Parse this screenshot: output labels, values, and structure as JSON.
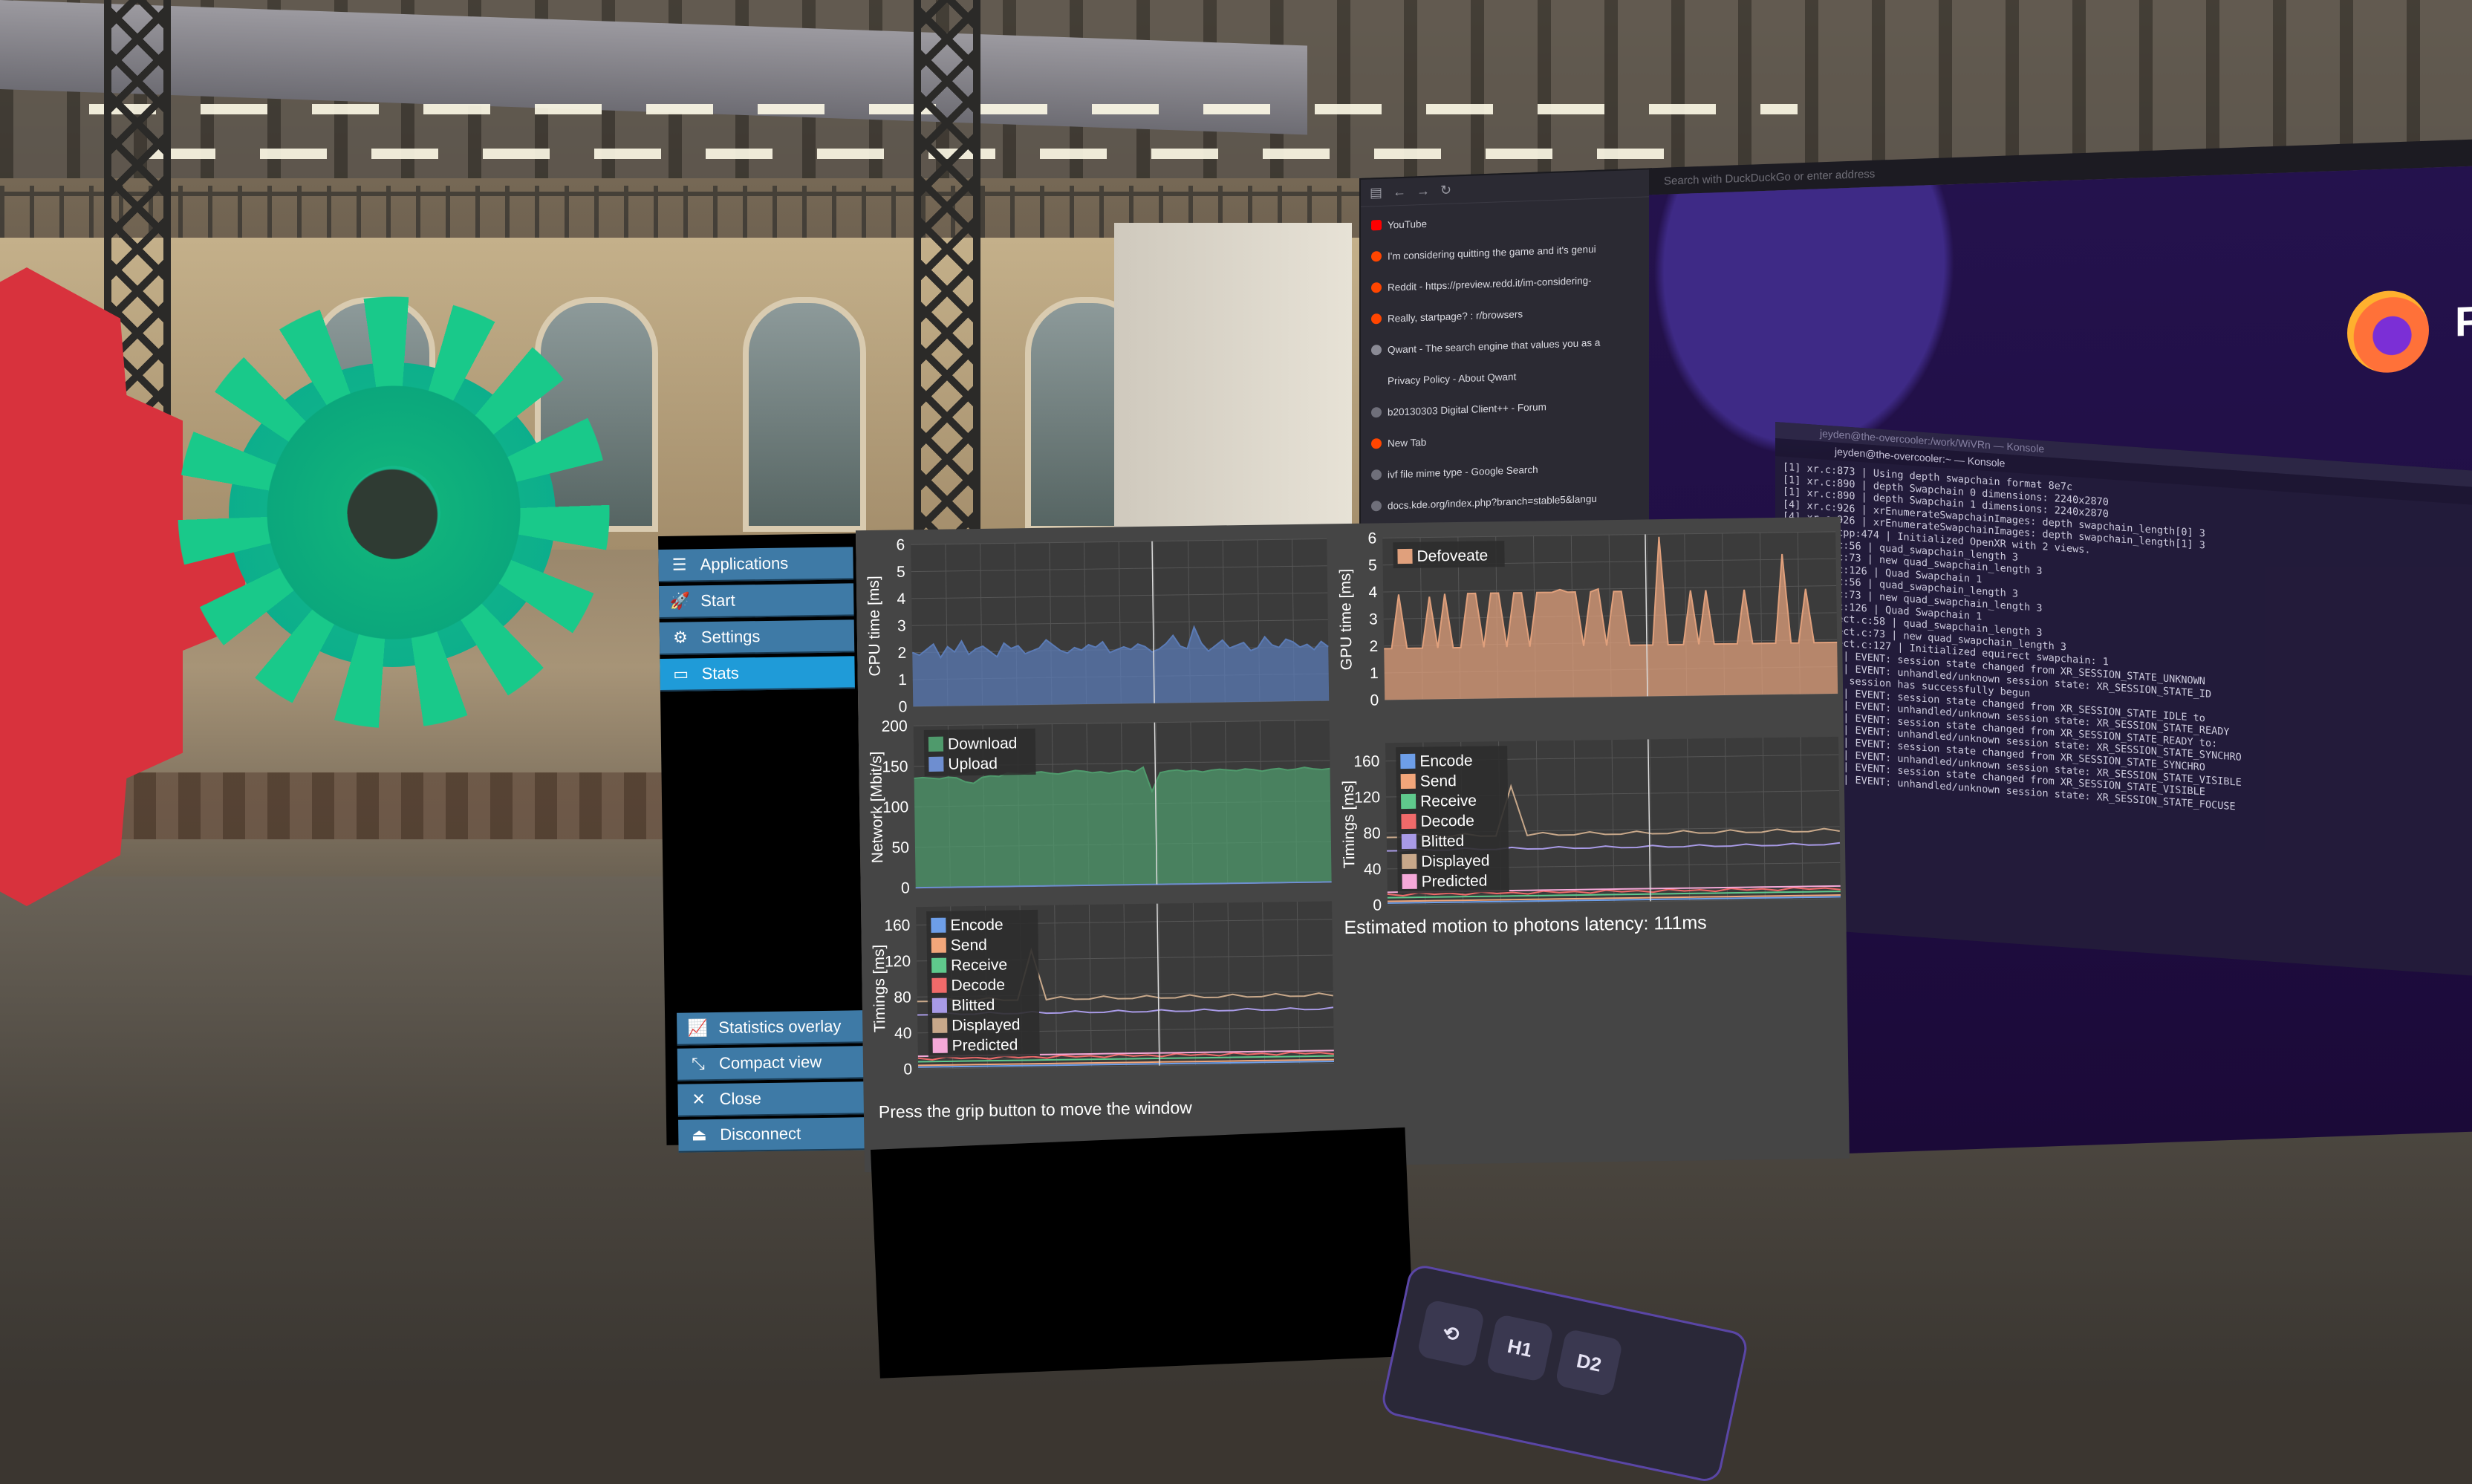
{
  "browser": {
    "url_placeholder": "Search with DuckDuckGo or enter address",
    "bookmarks": [
      {
        "icon": "youtube-icon",
        "label": "YouTube"
      },
      {
        "icon": "reddit-icon",
        "label": "I'm considering quitting the game and it's genui"
      },
      {
        "icon": "reddit-icon",
        "label": "Reddit - https://preview.redd.it/im-considering-"
      },
      {
        "icon": "reddit-icon",
        "label": "Really, startpage? : r/browsers"
      },
      {
        "icon": "qwant-icon",
        "label": "Qwant - The search engine that values you as a"
      },
      {
        "icon": "none",
        "label": "Privacy Policy - About Qwant"
      },
      {
        "icon": "globe-icon",
        "label": "b20130303 Digital Client++ - Forum"
      },
      {
        "icon": "firefox-icon",
        "label": "New Tab"
      },
      {
        "icon": "globe-icon",
        "label": "ivf file mime type - Google Search"
      },
      {
        "icon": "globe-icon",
        "label": "docs.kde.org/index.php?branch=stable5&langu"
      }
    ],
    "ff_letter": "F"
  },
  "konsole": {
    "window_title": "jeyden@the-overcooler:/work/WiVRn — Konsole",
    "tab_title": "jeyden@the-overcooler:~ — Konsole",
    "lines": [
      "[1] xr.c:873 | Using depth swapchain format 8e7c",
      "[1] xr.c:890 | depth Swapchain 0 dimensions: 2240x2870",
      "[1] xr.c:890 | depth Swapchain 1 dimensions: 2240x2870",
      "[4] xr.c:926 | xrEnumerateSwapchainImages: depth swapchain_length[0] 3",
      "[4] xr.c:926 | xrEnumerateSwapchainImages: depth swapchain_length[1] 3",
      "[4] main.cpp:474 | Initialized OpenXR with 2 views.",
      "    quad.c:56 | quad_swapchain_length 3",
      "    quad.c:73 | new quad_swapchain_length 3",
      "    quad.c:126 | Quad Swapchain 1",
      "    quad.c:56 | quad_swapchain_length 3",
      "    quad.c:73 | new quad_swapchain_length 3",
      "    quad.c:126 | Quad Swapchain 1",
      "    equirect.c:58 | quad_swapchain_length 3",
      "    equirect.c:73 | new quad_swapchain_length 3",
      "    equirect.c:127 | Initialized equirect swapchain: 1",
      "    :1019 | EVENT: session state changed from XR_SESSION_STATE_UNKNOWN",
      "    :1040 | EVENT: unhandled/unknown session state: XR_SESSION_STATE_ID",
      "    :726 | session has successfully begun",
      "    :1019 | EVENT: session state changed from XR_SESSION_STATE_IDLE to",
      "    :1040 | EVENT: unhandled/unknown session state: XR_SESSION_STATE_READY",
      "    :1019 | EVENT: session state changed from XR_SESSION_STATE_READY to:",
      "    :1040 | EVENT: unhandled/unknown session state: XR_SESSION_STATE_SYNCHRO",
      "    :1019 | EVENT: session state changed from XR_SESSION_STATE_SYNCHRO",
      "    :1040 | EVENT: unhandled/unknown session state: XR_SESSION_STATE_VISIBLE",
      "    :1019 | EVENT: session state changed from XR_SESSION_STATE_VISIBLE",
      "    :1040 | EVENT: unhandled/unknown session state: XR_SESSION_STATE_FOCUSE"
    ]
  },
  "sidebar": {
    "top_items": [
      {
        "icon": "list-icon",
        "label": "Applications",
        "active": false
      },
      {
        "icon": "rocket-icon",
        "label": "Start",
        "active": false
      },
      {
        "icon": "gears-icon",
        "label": "Settings",
        "active": false
      },
      {
        "icon": "monitor-icon",
        "label": "Stats",
        "active": true
      }
    ],
    "bottom_items": [
      {
        "icon": "chart-line-icon",
        "label": "Statistics overlay"
      },
      {
        "icon": "compress-icon",
        "label": "Compact view"
      },
      {
        "icon": "close-icon",
        "label": "Close"
      },
      {
        "icon": "disconnect-icon",
        "label": "Disconnect"
      }
    ]
  },
  "stats": {
    "latency_label": "Estimated motion to photons latency: 111ms",
    "hint": "Press the grip button to move the window"
  },
  "chart_data": [
    {
      "id": "cpu-time",
      "type": "area",
      "ylabel": "CPU time [ms]",
      "ylim": [
        0,
        6
      ],
      "yticks": [
        0,
        1,
        2,
        3,
        4,
        5,
        6
      ],
      "series": [
        {
          "values": [
            2.0,
            1.9,
            2.1,
            2.3,
            1.8,
            2.2,
            2.0,
            2.4,
            1.9,
            2.1,
            2.2,
            2.0,
            1.8,
            2.3,
            2.1,
            2.2,
            1.9,
            2.0,
            2.1,
            2.4,
            2.2,
            2.0,
            1.9,
            2.1,
            2.0,
            2.2,
            2.1,
            2.3,
            1.9,
            2.0,
            2.1,
            2.0,
            2.2,
            2.1,
            1.9,
            2.0,
            2.2,
            2.5,
            2.1,
            2.0,
            2.8,
            2.2,
            1.9,
            2.1,
            2.3,
            2.0,
            2.1,
            2.2,
            1.9,
            2.0,
            2.4,
            2.1,
            2.0,
            2.3,
            2.2,
            2.0,
            2.1,
            1.9,
            2.2,
            2.0
          ],
          "color": "#5b7bb5"
        }
      ],
      "grid": true
    },
    {
      "id": "gpu-time",
      "type": "area",
      "ylabel": "GPU time [ms]",
      "ylim": [
        0,
        6
      ],
      "yticks": [
        0,
        1,
        2,
        3,
        4,
        5,
        6
      ],
      "series": [
        {
          "name": "Defoveate",
          "values": [
            1.9,
            1.9,
            3.9,
            1.9,
            1.9,
            1.9,
            3.8,
            1.9,
            3.9,
            1.9,
            1.9,
            3.9,
            3.9,
            1.9,
            3.9,
            3.9,
            1.9,
            3.9,
            3.9,
            1.9,
            3.9,
            3.9,
            3.9,
            4.0,
            3.9,
            3.9,
            1.9,
            3.9,
            4.0,
            1.9,
            3.9,
            3.9,
            1.9,
            1.9,
            1.9,
            1.9,
            5.9,
            1.9,
            1.9,
            1.9,
            3.9,
            1.9,
            3.9,
            1.9,
            1.9,
            1.9,
            1.9,
            3.9,
            1.9,
            1.9,
            1.9,
            1.9,
            5.2,
            1.9,
            1.9,
            3.9,
            1.9,
            1.9,
            1.9,
            1.9
          ],
          "color": "#e0a07c"
        }
      ],
      "legend": "top-left",
      "grid": true
    },
    {
      "id": "network",
      "type": "area",
      "ylabel": "Network [Mbit/s]",
      "ylim": [
        0,
        200
      ],
      "yticks": [
        0,
        50,
        100,
        150,
        200
      ],
      "series": [
        {
          "name": "Download",
          "values": [
            135,
            136,
            135,
            134,
            136,
            135,
            130,
            128,
            135,
            137,
            136,
            140,
            139,
            138,
            140,
            141,
            139,
            138,
            140,
            142,
            141,
            139,
            140,
            138,
            140,
            141,
            139,
            145,
            115,
            138,
            140,
            141,
            139,
            140,
            138,
            140,
            141,
            140,
            139,
            141,
            140,
            138,
            140,
            141,
            139,
            140,
            142,
            140,
            139,
            140
          ],
          "color": "#4f9a6c"
        },
        {
          "name": "Upload",
          "values": [
            0,
            0,
            0,
            0,
            0,
            0,
            0,
            0,
            0,
            0,
            0,
            0,
            0,
            0,
            0,
            0,
            0,
            0,
            0,
            0,
            0,
            0,
            0,
            0,
            0,
            0,
            0,
            0,
            0,
            0,
            0,
            0,
            0,
            0,
            0,
            0,
            0,
            0,
            0,
            0,
            0,
            0,
            0,
            0,
            0,
            0,
            0,
            0,
            0,
            0
          ],
          "color": "#6e8ed0"
        }
      ],
      "legend": "top-left",
      "grid": true
    },
    {
      "id": "timings-encoder",
      "type": "line",
      "ylabel": "Timings [ms]",
      "ylim": [
        0,
        180
      ],
      "yticks": [
        0,
        40,
        80,
        120,
        160
      ],
      "series": [
        {
          "name": "Encode",
          "color": "#6d9ee8",
          "values": [
            2,
            2,
            2,
            2,
            2,
            2,
            2,
            2,
            2,
            2,
            2,
            2,
            2,
            2,
            2,
            2,
            2,
            2,
            2,
            2,
            2,
            2,
            2,
            2,
            2,
            2,
            2,
            2,
            2,
            2
          ]
        },
        {
          "name": "Send",
          "color": "#f2a67a",
          "values": [
            4,
            4,
            4,
            4,
            4,
            4,
            4,
            4,
            4,
            4,
            4,
            4,
            4,
            4,
            4,
            4,
            4,
            4,
            4,
            4,
            4,
            4,
            4,
            4,
            4,
            4,
            4,
            4,
            4,
            4
          ]
        },
        {
          "name": "Receive",
          "color": "#5fc98c",
          "values": [
            8,
            8,
            8,
            8,
            8,
            8,
            8,
            8,
            8,
            8,
            8,
            8,
            8,
            8,
            8,
            8,
            8,
            8,
            8,
            8,
            8,
            8,
            8,
            8,
            8,
            8,
            8,
            8,
            8,
            8
          ]
        },
        {
          "name": "Decode",
          "color": "#f06a6a",
          "values": [
            12,
            10,
            13,
            11,
            12,
            10,
            13,
            11,
            12,
            10,
            13,
            11,
            12,
            10,
            13,
            11,
            12,
            10,
            13,
            11,
            12,
            10,
            13,
            11,
            12,
            10,
            13,
            11,
            12,
            10
          ]
        },
        {
          "name": "Blitted",
          "color": "#a89ae6",
          "values": [
            60,
            60,
            62,
            60,
            60,
            62,
            60,
            60,
            62,
            60,
            60,
            62,
            60,
            60,
            62,
            60,
            60,
            62,
            60,
            60,
            62,
            60,
            60,
            62,
            60,
            60,
            62,
            60,
            60,
            62
          ]
        },
        {
          "name": "Displayed",
          "color": "#c8a88a",
          "values": [
            75,
            75,
            78,
            75,
            75,
            78,
            75,
            75,
            130,
            75,
            78,
            75,
            75,
            78,
            75,
            75,
            78,
            75,
            75,
            78,
            75,
            75,
            78,
            75,
            75,
            78,
            75,
            75,
            78,
            75
          ]
        },
        {
          "name": "Predicted",
          "color": "#f4a8d8",
          "values": [
            14,
            14,
            14,
            14,
            14,
            14,
            14,
            14,
            14,
            14,
            14,
            14,
            14,
            14,
            14,
            14,
            14,
            14,
            14,
            14,
            14,
            14,
            14,
            14,
            14,
            14,
            14,
            14,
            14,
            14
          ]
        }
      ],
      "legend": "top-left",
      "grid": true
    },
    {
      "id": "timings-decoder",
      "type": "line",
      "ylabel": "Timings [ms]",
      "ylim": [
        0,
        180
      ],
      "yticks": [
        0,
        40,
        80,
        120,
        160
      ],
      "series": [
        {
          "name": "Encode",
          "color": "#6d9ee8",
          "values": [
            2,
            2,
            2,
            2,
            2,
            2,
            2,
            2,
            2,
            2,
            2,
            2,
            2,
            2,
            2,
            2,
            2,
            2,
            2,
            2,
            2,
            2,
            2,
            2,
            2,
            2,
            2,
            2,
            2,
            2
          ]
        },
        {
          "name": "Send",
          "color": "#f2a67a",
          "values": [
            4,
            4,
            4,
            4,
            4,
            4,
            4,
            4,
            4,
            4,
            4,
            4,
            4,
            4,
            4,
            4,
            4,
            4,
            4,
            4,
            4,
            4,
            4,
            4,
            4,
            4,
            4,
            4,
            4,
            4
          ]
        },
        {
          "name": "Receive",
          "color": "#5fc98c",
          "values": [
            8,
            8,
            8,
            8,
            8,
            8,
            8,
            8,
            8,
            8,
            8,
            8,
            8,
            8,
            8,
            8,
            8,
            8,
            8,
            8,
            8,
            8,
            8,
            8,
            8,
            8,
            8,
            8,
            8,
            8
          ]
        },
        {
          "name": "Decode",
          "color": "#f06a6a",
          "values": [
            12,
            10,
            13,
            11,
            12,
            10,
            13,
            11,
            12,
            10,
            13,
            11,
            12,
            10,
            13,
            11,
            12,
            10,
            13,
            11,
            12,
            10,
            13,
            11,
            12,
            10,
            13,
            11,
            12,
            10
          ]
        },
        {
          "name": "Blitted",
          "color": "#a89ae6",
          "values": [
            60,
            60,
            62,
            60,
            60,
            62,
            60,
            60,
            62,
            60,
            60,
            62,
            60,
            60,
            62,
            60,
            60,
            62,
            60,
            60,
            62,
            60,
            60,
            62,
            60,
            60,
            62,
            60,
            60,
            62
          ]
        },
        {
          "name": "Displayed",
          "color": "#c8a88a",
          "values": [
            75,
            75,
            78,
            75,
            75,
            78,
            75,
            75,
            130,
            75,
            78,
            75,
            75,
            78,
            75,
            75,
            78,
            75,
            75,
            78,
            75,
            75,
            78,
            75,
            75,
            78,
            75,
            75,
            78,
            75
          ]
        },
        {
          "name": "Predicted",
          "color": "#f4a8d8",
          "values": [
            14,
            14,
            14,
            14,
            14,
            14,
            14,
            14,
            14,
            14,
            14,
            14,
            14,
            14,
            14,
            14,
            14,
            14,
            14,
            14,
            14,
            14,
            14,
            14,
            14,
            14,
            14,
            14,
            14,
            14
          ]
        }
      ],
      "legend": "top-left",
      "grid": true
    }
  ],
  "dock": {
    "buttons": [
      {
        "icon": "recenter-icon",
        "label": "⟲"
      },
      {
        "icon": "monitor-h1-icon",
        "label": "H1"
      },
      {
        "icon": "monitor-d2-icon",
        "label": "D2"
      }
    ]
  }
}
